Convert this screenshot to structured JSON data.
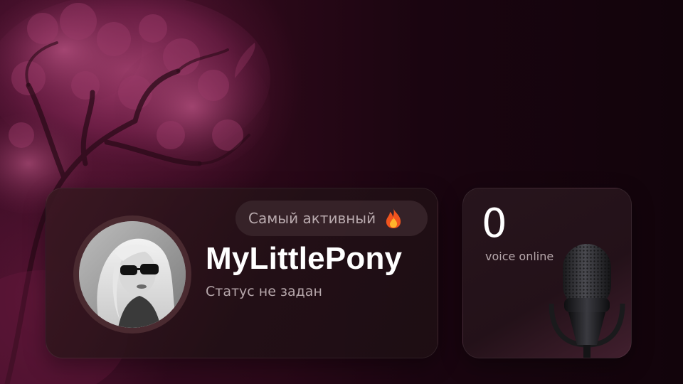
{
  "profile": {
    "badge_label": "Самый активный",
    "badge_icon": "fire-icon",
    "username": "MyLittlePony",
    "status": "Статус не задан",
    "avatar": "user-avatar"
  },
  "voice": {
    "count": "0",
    "label": "voice online",
    "icon": "microphone-icon"
  },
  "colors": {
    "background_dark": "#12040b",
    "background_accent": "#3a0c24",
    "card_bg": "#24121a",
    "badge_bg": "#3a262c",
    "text_primary": "#ffffff",
    "text_secondary": "#b7a8ac"
  }
}
